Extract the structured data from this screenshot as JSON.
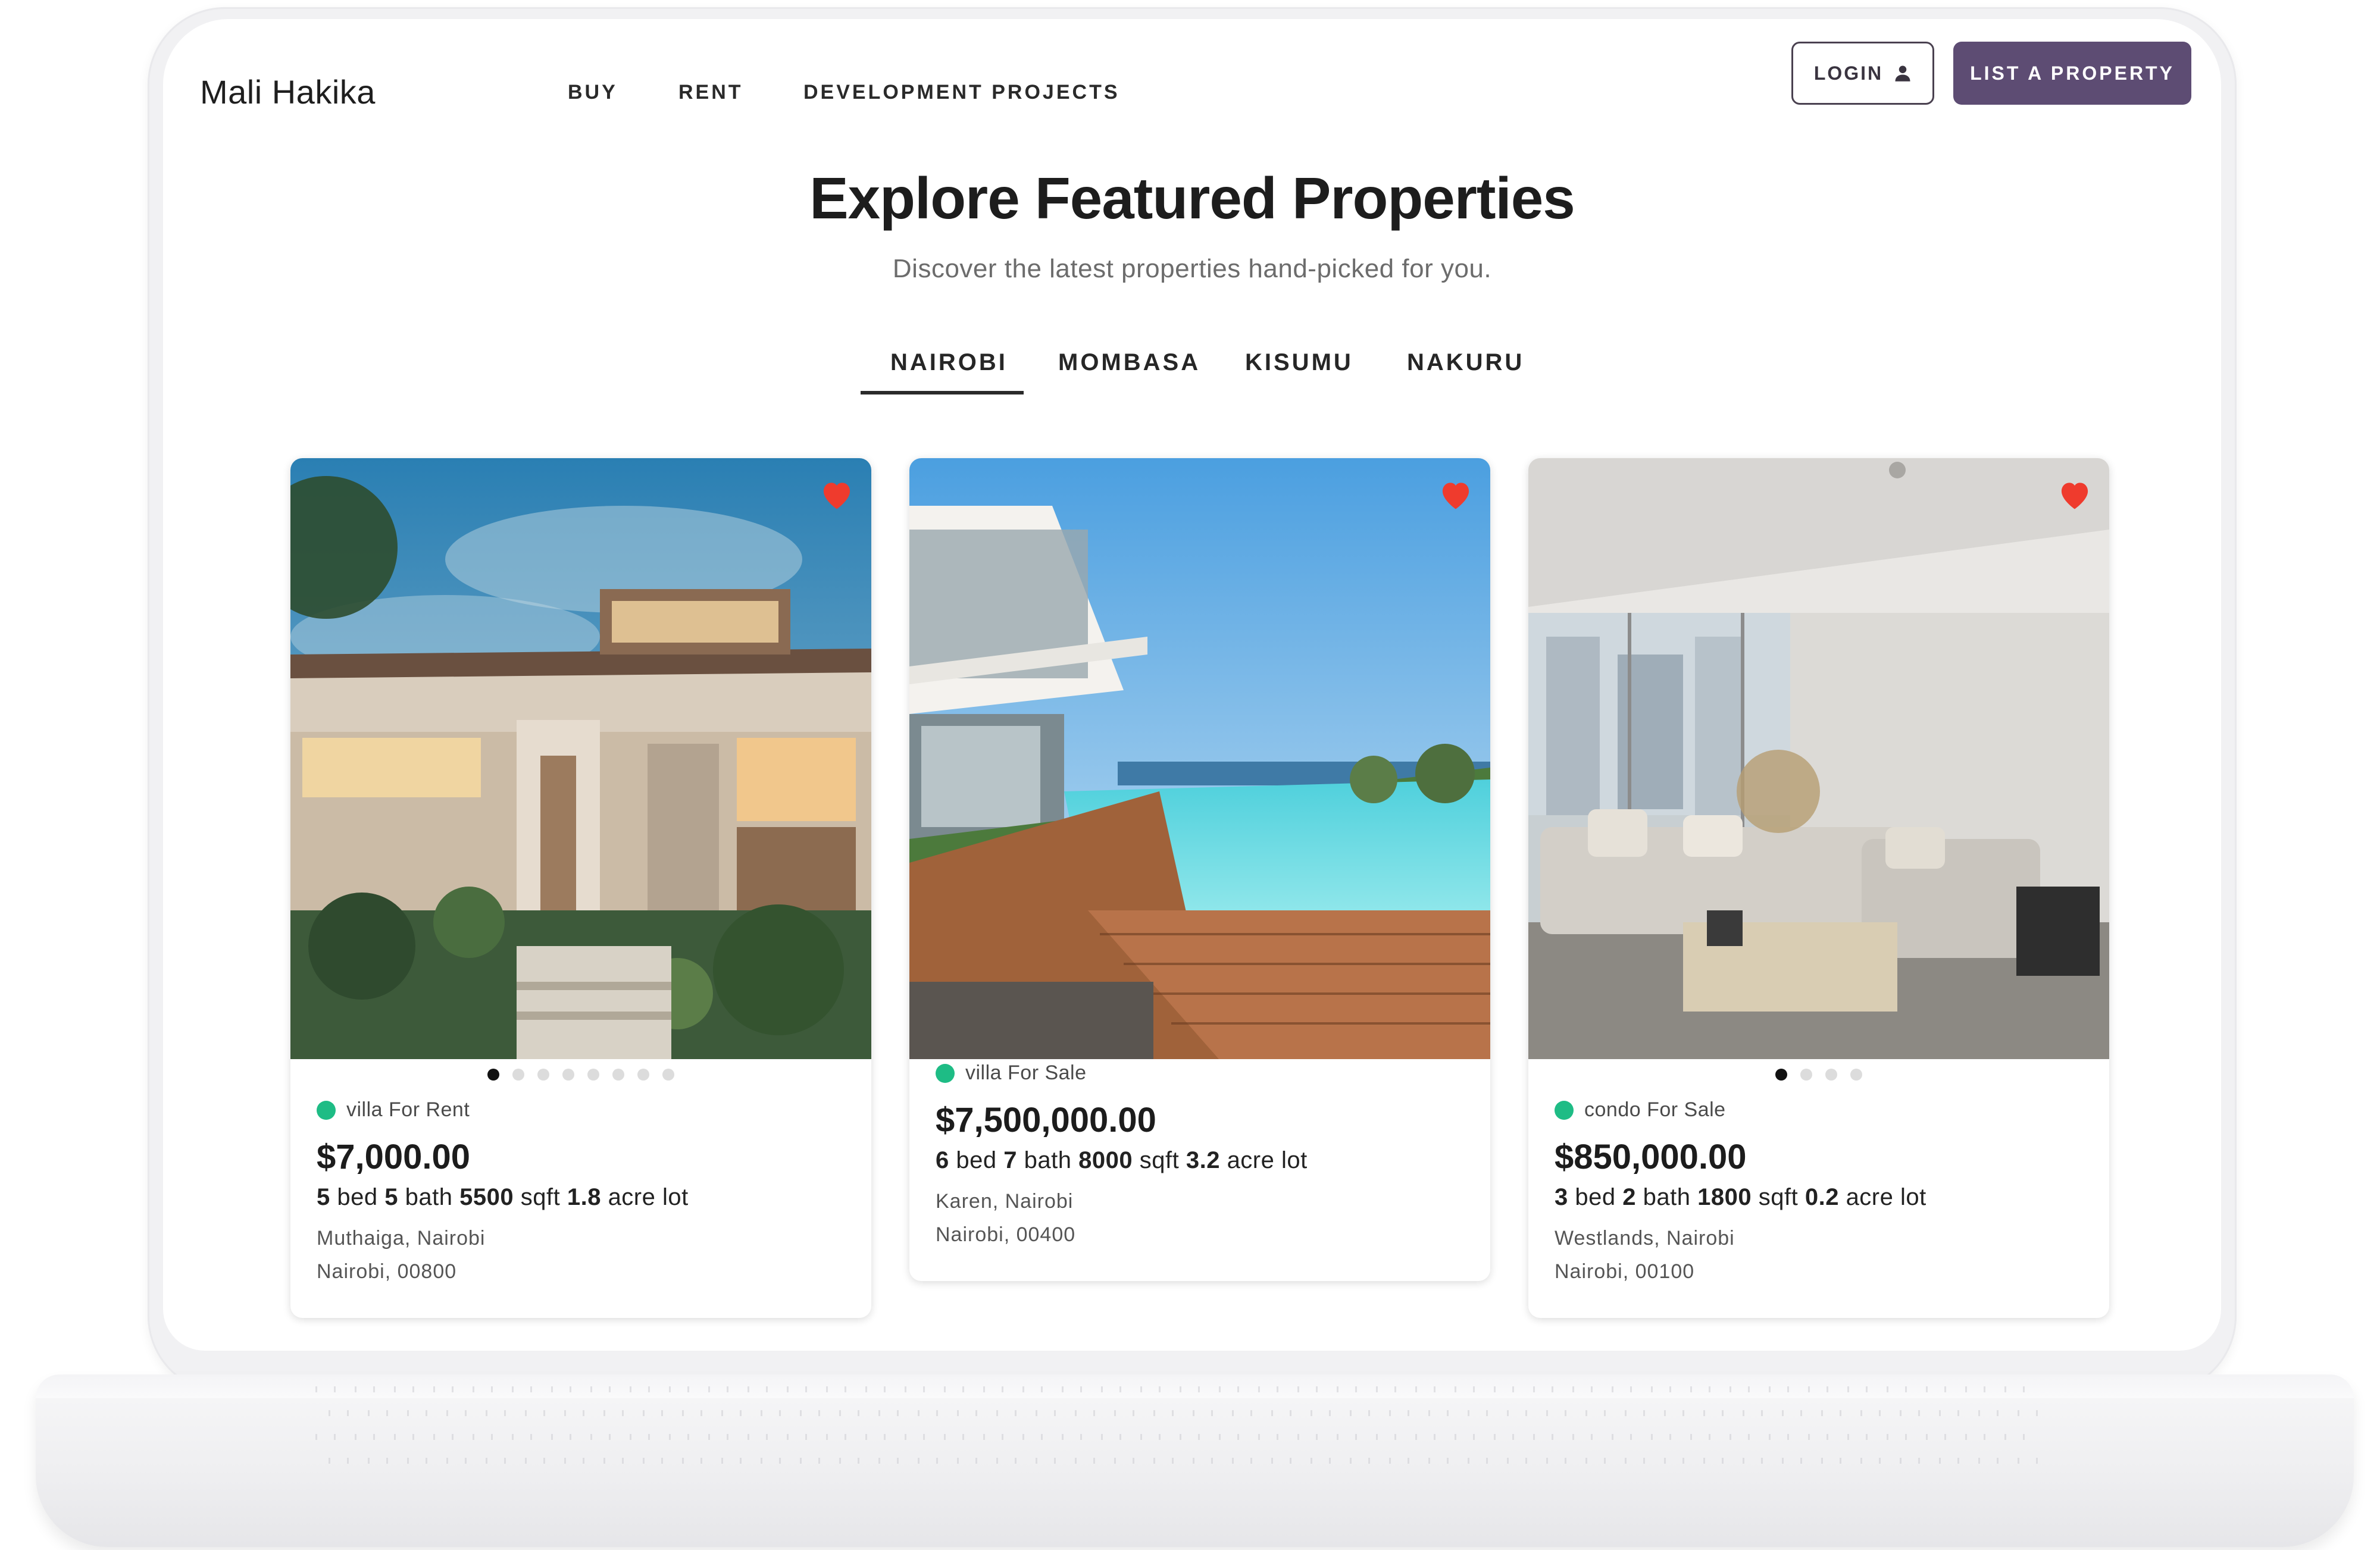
{
  "brand": {
    "name": "Mali Hakika",
    "accent_color": "#5d4c73"
  },
  "nav": {
    "links": [
      "BUY",
      "RENT",
      "DEVELOPMENT PROJECTS"
    ],
    "login_label": "LOGIN",
    "login_icon": "user-icon",
    "list_property_label": "LIST A PROPERTY"
  },
  "hero": {
    "title": "Explore Featured Properties",
    "subtitle": "Discover the latest properties hand-picked for you."
  },
  "tabs": {
    "items": [
      "NAIROBI",
      "MOMBASA",
      "KISUMU",
      "NAKURU"
    ],
    "active": "NAIROBI"
  },
  "properties": [
    {
      "status": "villa For Rent",
      "price": "$7,000.00",
      "beds": "5",
      "bed_label": "bed",
      "baths": "5",
      "bath_label": "bath",
      "sqft": "5500",
      "sqft_label": "sqft",
      "lot": "1.8",
      "lot_label": "acre lot",
      "address_line1": "Muthaiga, Nairobi",
      "address_line2": "Nairobi, 00800",
      "photo": "modern-villa-exterior-dusk",
      "photo_count": 8,
      "current_photo": 1,
      "favorited": true
    },
    {
      "status": "villa For Sale",
      "price": "$7,500,000.00",
      "beds": "6",
      "bed_label": "bed",
      "baths": "7",
      "bath_label": "bath",
      "sqft": "8000",
      "sqft_label": "sqft",
      "lot": "3.2",
      "lot_label": "acre lot",
      "address_line1": "Karen, Nairobi",
      "address_line2": "Nairobi, 00400",
      "photo": "villa-infinity-pool-sea-view",
      "photo_count": 0,
      "current_photo": 0,
      "favorited": true
    },
    {
      "status": "condo For Sale",
      "price": "$850,000.00",
      "beds": "3",
      "bed_label": "bed",
      "baths": "2",
      "bath_label": "bath",
      "sqft": "1800",
      "sqft_label": "sqft",
      "lot": "0.2",
      "lot_label": "acre lot",
      "address_line1": "Westlands, Nairobi",
      "address_line2": "Nairobi, 00100",
      "photo": "condo-living-room-interior",
      "photo_count": 4,
      "current_photo": 1,
      "favorited": true
    }
  ],
  "colors": {
    "status_green": "#1ebc85",
    "heart_red": "#ef3b2d"
  }
}
